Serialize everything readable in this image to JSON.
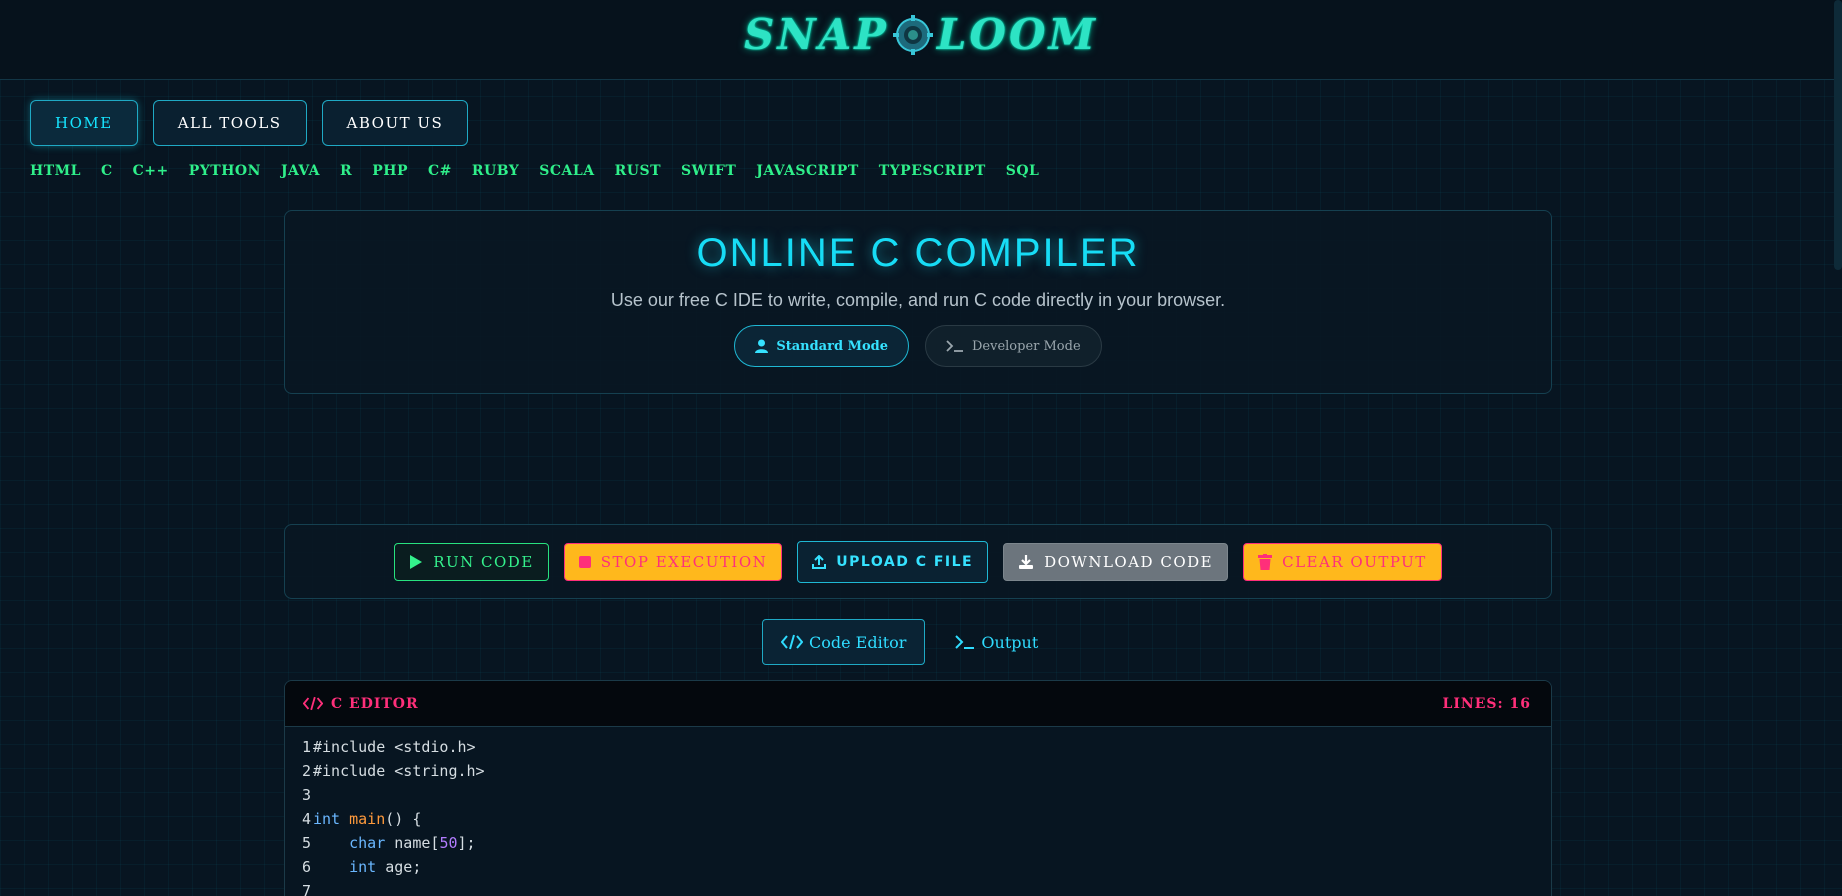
{
  "header": {
    "logo_left": "SNAP",
    "logo_right": "LOOM"
  },
  "nav": {
    "items": [
      "HOME",
      "ALL TOOLS",
      "ABOUT US"
    ],
    "active": "HOME"
  },
  "languages": [
    "HTML",
    "C",
    "C++",
    "PYTHON",
    "JAVA",
    "R",
    "PHP",
    "C#",
    "RUBY",
    "SCALA",
    "RUST",
    "SWIFT",
    "JAVASCRIPT",
    "TYPESCRIPT",
    "SQL"
  ],
  "hero": {
    "title": "ONLINE C COMPILER",
    "subtitle": "Use our free C IDE to write, compile, and run C code directly in your browser.",
    "modes": {
      "standard": "Standard Mode",
      "developer": "Developer Mode"
    }
  },
  "toolbar": {
    "run": "RUN CODE",
    "stop": "STOP EXECUTION",
    "upload": "UPLOAD C FILE",
    "download": "DOWNLOAD CODE",
    "clear": "CLEAR OUTPUT"
  },
  "tabs": {
    "editor": "Code Editor",
    "output": "Output"
  },
  "editor": {
    "title": "C EDITOR",
    "lines_label": "LINES: 16",
    "code": [
      "#include <stdio.h>",
      "#include <string.h>",
      "",
      "int main() {",
      "    char name[50];",
      "    int age;",
      ""
    ]
  },
  "colors": {
    "accent": "#17dcf5",
    "green": "#2fef8a",
    "pink": "#ff2f7a",
    "amber": "#ffb81c"
  }
}
